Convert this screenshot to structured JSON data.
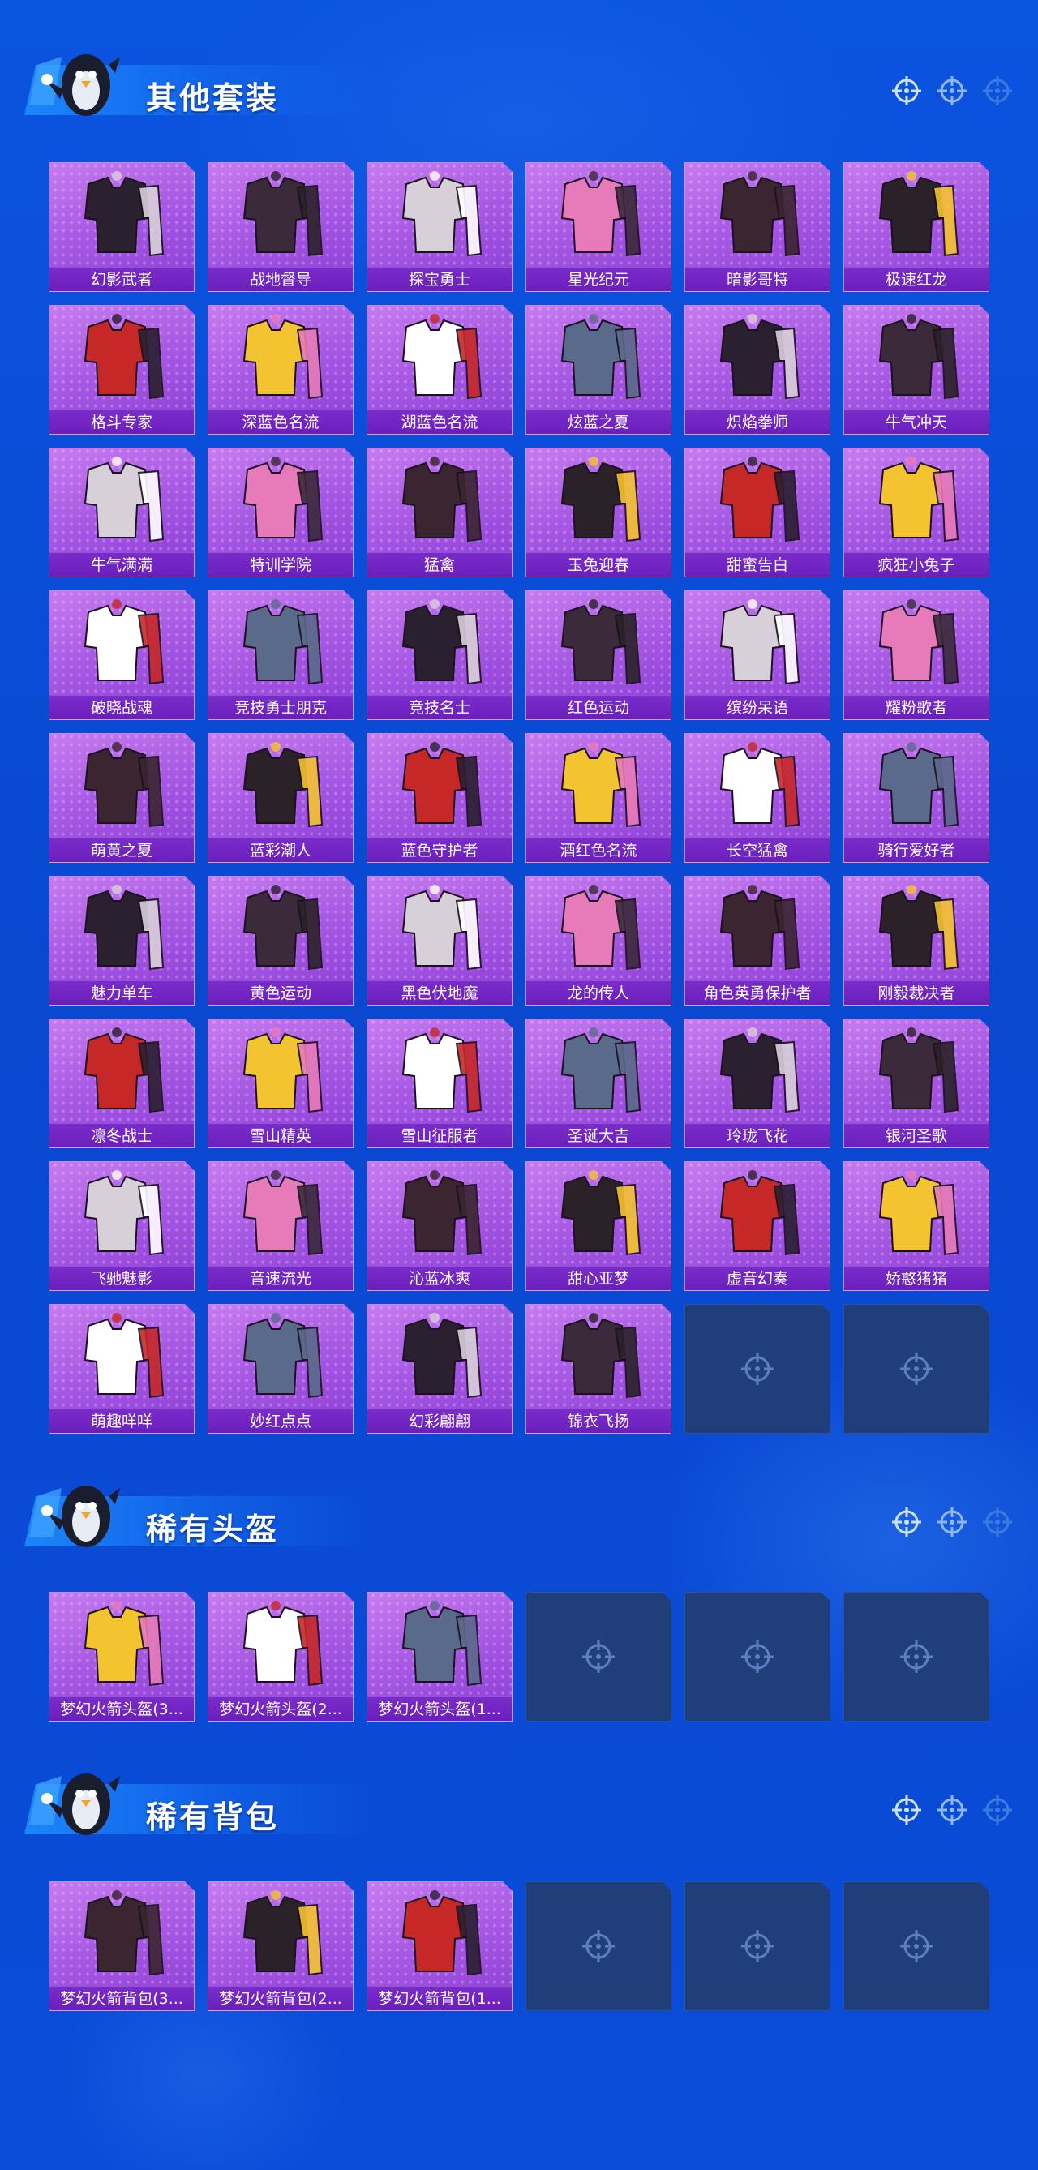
{
  "sections": [
    {
      "title": "其他套装",
      "items": [
        "幻影武者",
        "战地督导",
        "探宝勇士",
        "星光纪元",
        "暗影哥特",
        "极速红龙",
        "格斗专家",
        "深蓝色名流",
        "湖蓝色名流",
        "炫蓝之夏",
        "炽焰拳师",
        "牛气冲天",
        "牛气满满",
        "特训学院",
        "猛禽",
        "玉兔迎春",
        "甜蜜告白",
        "疯狂小兔子",
        "破晓战魂",
        "竞技勇士朋克",
        "竞技名士",
        "红色运动",
        "缤纷呆语",
        "耀粉歌者",
        "萌黄之夏",
        "蓝彩潮人",
        "蓝色守护者",
        "酒红色名流",
        "长空猛禽",
        "骑行爱好者",
        "魅力单车",
        "黄色运动",
        "黑色伏地魔",
        "龙的传人",
        "角色英勇保护者",
        "刚毅裁决者",
        "凛冬战士",
        "雪山精英",
        "雪山征服者",
        "圣诞大吉",
        "玲珑飞花",
        "银河圣歌",
        "飞驰魅影",
        "音速流光",
        "沁蓝冰爽",
        "甜心亚梦",
        "虚音幻奏",
        "娇憨猪猪",
        "萌趣咩咩",
        "妙红点点",
        "幻彩翩翩",
        "锦衣飞扬"
      ],
      "empty_slots": 2
    },
    {
      "title": "稀有头盔",
      "items": [
        "梦幻火箭头盔(3...",
        "梦幻火箭头盔(2...",
        "梦幻火箭头盔(1..."
      ],
      "empty_slots": 3
    },
    {
      "title": "稀有背包",
      "items": [
        "梦幻火箭背包(3...",
        "梦幻火箭背包(2...",
        "梦幻火箭背包(1..."
      ],
      "empty_slots": 3
    }
  ],
  "icons": {
    "mascot": "penguin-mascot-icon",
    "crosshair": "crosshair-icon",
    "empty_slot": "crosshair-placeholder-icon"
  },
  "colors": {
    "background": "#0a4ad4",
    "card_purple": "#a657e3",
    "label_purple": "#6a1fbd",
    "empty_slot": "#1f3e7a"
  }
}
